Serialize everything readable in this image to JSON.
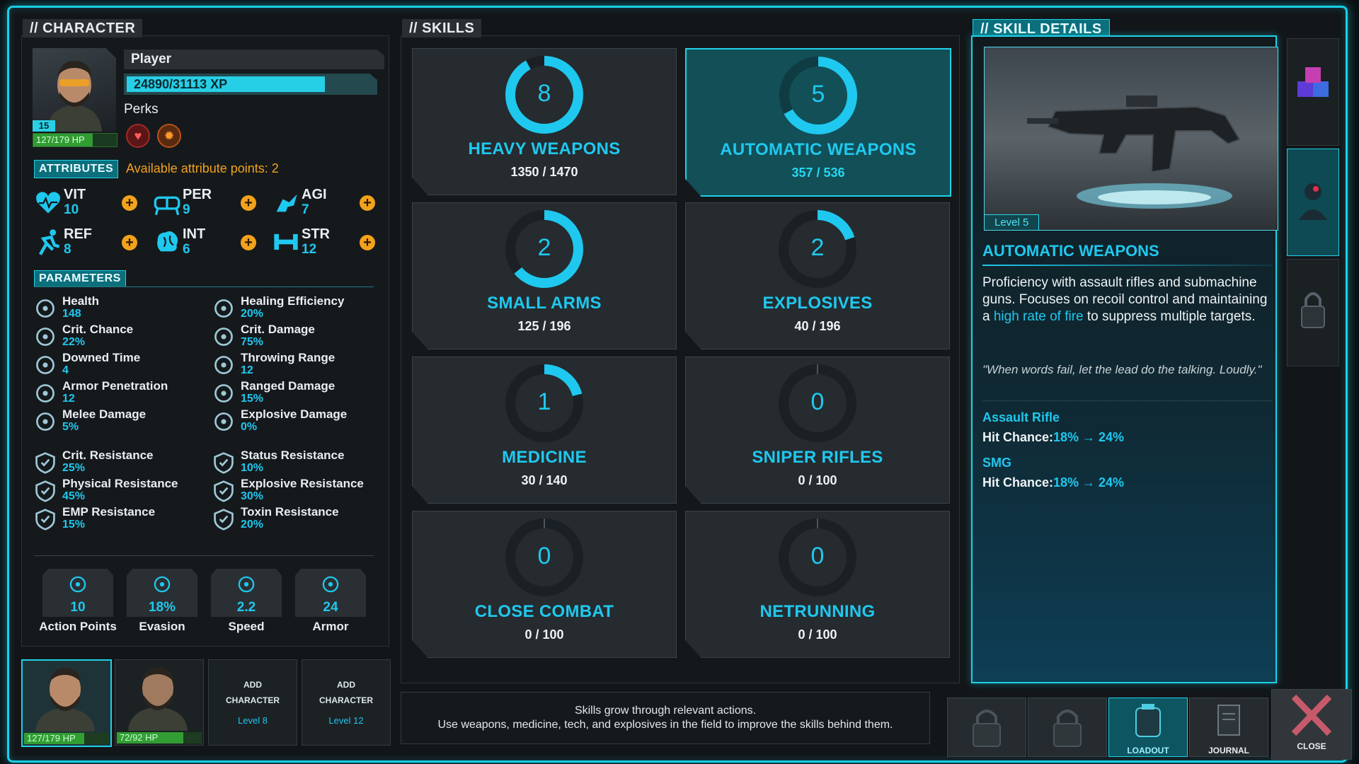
{
  "character": {
    "tab": "// CHARACTER",
    "name": "Player",
    "xp": "24890/31113 XP",
    "xp_fraction": 0.8,
    "level": "15",
    "hp": "127/179 HP",
    "hp_fraction": 0.71,
    "perks_label": "Perks",
    "attributes_tab": "ATTRIBUTES",
    "available_points": "Available attribute points: 2",
    "attributes": [
      {
        "code": "VIT",
        "value": "10",
        "icon": "heartbeat-icon"
      },
      {
        "code": "PER",
        "value": "9",
        "icon": "goggles-icon"
      },
      {
        "code": "AGI",
        "value": "7",
        "icon": "winged-boot-icon"
      },
      {
        "code": "REF",
        "value": "8",
        "icon": "running-icon"
      },
      {
        "code": "INT",
        "value": "6",
        "icon": "brain-icon"
      },
      {
        "code": "STR",
        "value": "12",
        "icon": "dumbbell-icon"
      }
    ],
    "parameters_tab": "PARAMETERS",
    "parameters": [
      {
        "label": "Health",
        "value": "148"
      },
      {
        "label": "Healing Efficiency",
        "value": "20%"
      },
      {
        "label": "Crit. Chance",
        "value": "22%"
      },
      {
        "label": "Crit. Damage",
        "value": "75%"
      },
      {
        "label": "Downed Time",
        "value": "4"
      },
      {
        "label": "Throwing Range",
        "value": "12"
      },
      {
        "label": "Armor Penetration",
        "value": "12"
      },
      {
        "label": "Ranged Damage",
        "value": "15%"
      },
      {
        "label": "Melee Damage",
        "value": "5%"
      },
      {
        "label": "Explosive Damage",
        "value": "0%"
      }
    ],
    "resistances": [
      {
        "label": "Crit. Resistance",
        "value": "25%"
      },
      {
        "label": "Status Resistance",
        "value": "10%"
      },
      {
        "label": "Physical Resistance",
        "value": "45%"
      },
      {
        "label": "Explosive Resistance",
        "value": "30%"
      },
      {
        "label": "EMP Resistance",
        "value": "15%"
      },
      {
        "label": "Toxin Resistance",
        "value": "20%"
      }
    ],
    "stats": [
      {
        "label": "Action Points",
        "value": "10",
        "icon": "action-points-icon"
      },
      {
        "label": "Evasion",
        "value": "18%",
        "icon": "evasion-icon"
      },
      {
        "label": "Speed",
        "value": "2.2",
        "icon": "speed-icon"
      },
      {
        "label": "Armor",
        "value": "24",
        "icon": "armor-icon"
      }
    ]
  },
  "party": [
    {
      "hp": "127/179 HP",
      "hp_fraction": 0.71
    },
    {
      "hp": "72/92 HP",
      "hp_fraction": 0.78
    },
    {
      "add_line1": "ADD",
      "add_line2": "CHARACTER",
      "add_level": "Level 8"
    },
    {
      "add_line1": "ADD",
      "add_line2": "CHARACTER",
      "add_level": "Level 12"
    }
  ],
  "skills": {
    "tab": "// SKILLS",
    "items": [
      {
        "name": "HEAVY WEAPONS",
        "level": "8",
        "progress": "1350 / 1470",
        "fraction": 0.92
      },
      {
        "name": "AUTOMATIC WEAPONS",
        "level": "5",
        "progress": "357 / 536",
        "fraction": 0.67
      },
      {
        "name": "SMALL ARMS",
        "level": "2",
        "progress": "125 / 196",
        "fraction": 0.64
      },
      {
        "name": "EXPLOSIVES",
        "level": "2",
        "progress": "40 / 196",
        "fraction": 0.2
      },
      {
        "name": "MEDICINE",
        "level": "1",
        "progress": "30 / 140",
        "fraction": 0.21
      },
      {
        "name": "SNIPER RIFLES",
        "level": "0",
        "progress": "0 / 100",
        "fraction": 0
      },
      {
        "name": "CLOSE COMBAT",
        "level": "0",
        "progress": "0 / 100",
        "fraction": 0
      },
      {
        "name": "NETRUNNING",
        "level": "0",
        "progress": "0 / 100",
        "fraction": 0
      }
    ],
    "hint_line1": "Skills grow through relevant actions.",
    "hint_line2": "Use weapons, medicine, tech, and explosives in the field to improve the skills behind them."
  },
  "details": {
    "tab": "// SKILL DETAILS",
    "level_badge": "Level 5",
    "title": "AUTOMATIC WEAPONS",
    "desc_before": "Proficiency with assault rifles and submachine guns. Focuses on recoil control and maintaining a ",
    "desc_highlight": "high rate of fire",
    "desc_after": " to suppress multiple targets.",
    "quote": "\"When words fail, let the lead do the talking. Loudly.\"",
    "weapons": [
      {
        "name": "Assault Rifle",
        "stat_label": "Hit Chance:",
        "stat_value": "18% → 24%"
      },
      {
        "name": "SMG",
        "stat_label": "Hit Chance:",
        "stat_value": "18% → 24%"
      }
    ]
  },
  "bottom_nav": {
    "loadout": "LOADOUT",
    "journal": "JOURNAL",
    "close": "CLOSE"
  },
  "colors": {
    "accent": "#1fc8ee",
    "highlight": "#f2a21c",
    "hp": "#3cc63c"
  }
}
